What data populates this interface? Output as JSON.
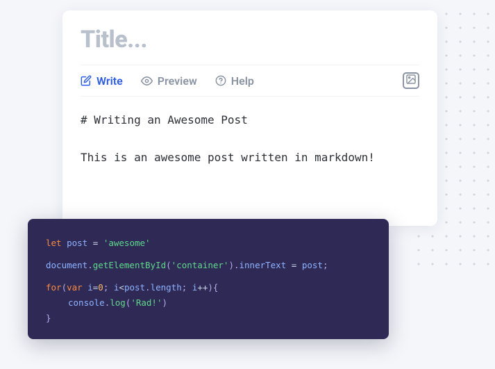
{
  "editor": {
    "title_placeholder": "Title...",
    "tabs": {
      "write": "Write",
      "preview": "Preview",
      "help": "Help"
    },
    "content": {
      "heading": "# Writing an Awesome Post",
      "body": "This is an awesome post written in markdown!"
    }
  },
  "code": {
    "line1": {
      "kw": "let",
      "var": "post",
      "op": "=",
      "str": "'awesome'"
    },
    "line2": {
      "obj": "document",
      "dot1": ".",
      "fn": "getElementById",
      "lp": "(",
      "arg": "'container'",
      "rp": ")",
      "dot2": ".",
      "prop": "innerText",
      "op": "=",
      "var": "post",
      "semi": ";"
    },
    "line3": {
      "kw": "for",
      "lp": "(",
      "decl": "var",
      "ivar": "i",
      "eq": "=",
      "zero": "0",
      "semi1": ";",
      "ivar2": "i",
      "lt": "<",
      "pvar": "post",
      "dot": ".",
      "len": "length",
      "semi2": ";",
      "ivar3": "i",
      "inc": "++",
      "rp": ")",
      "lb": "{"
    },
    "line4": {
      "obj": "console",
      "dot": ".",
      "fn": "log",
      "lp": "(",
      "arg": "'Rad!'",
      "rp": ")"
    },
    "line5": {
      "rb": "}"
    }
  }
}
